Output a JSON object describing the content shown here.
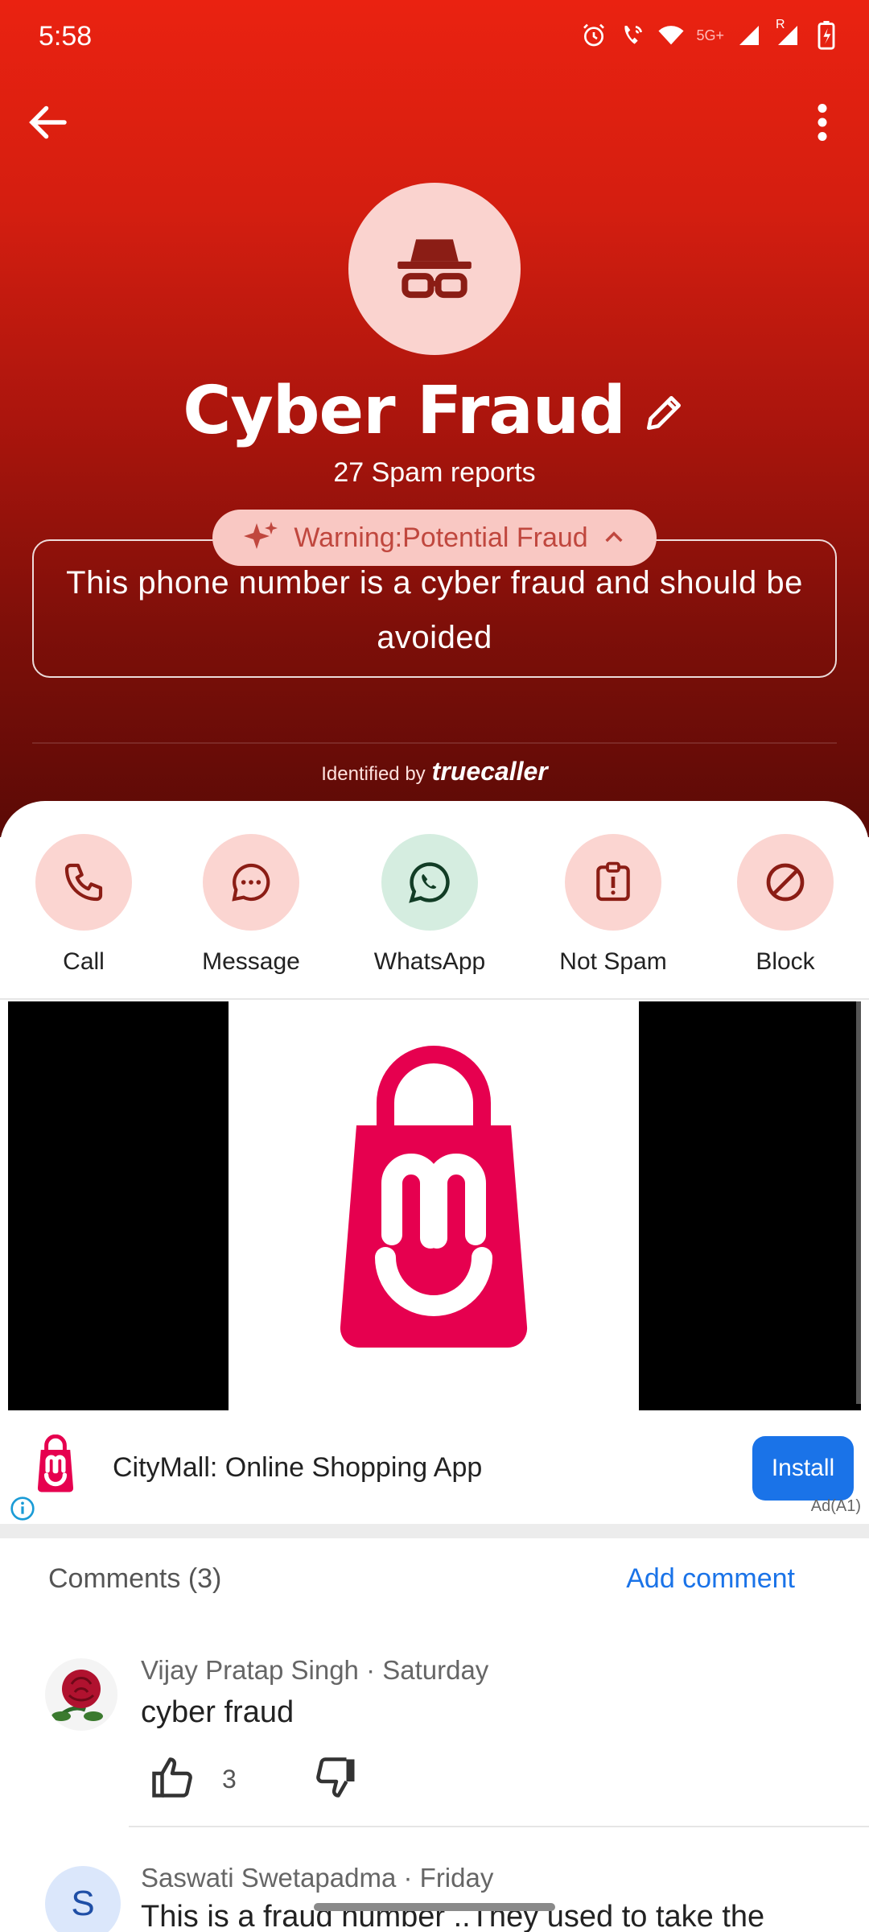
{
  "status_bar": {
    "time": "5:58",
    "network_label": "5G+",
    "roaming_label": "R"
  },
  "profile": {
    "title": "Cyber Fraud",
    "spam_reports": "27 Spam reports",
    "warning_label": "Warning:Potential Fraud",
    "warning_text": "This phone number is a cyber fraud and should be avoided",
    "identified_prefix": "Identified by",
    "identified_brand": "truecaller"
  },
  "actions": [
    {
      "label": "Call",
      "icon": "phone-icon"
    },
    {
      "label": "Message",
      "icon": "message-icon"
    },
    {
      "label": "WhatsApp",
      "icon": "whatsapp-icon"
    },
    {
      "label": "Not Spam",
      "icon": "not-spam-icon"
    },
    {
      "label": "Block",
      "icon": "block-icon"
    }
  ],
  "ad": {
    "app_name": "CityMall: Online Shopping App",
    "install_label": "Install",
    "tag": "Ad(A1)"
  },
  "comments": {
    "header": "Comments (3)",
    "add_label": "Add comment",
    "items": [
      {
        "author": "Vijay Pratap Singh · Saturday",
        "text": "cyber fraud",
        "likes": "3"
      },
      {
        "author": "Saswati Swetapadma · Friday",
        "initial": "S",
        "text": "This is a fraud number ..They used to take the"
      }
    ]
  },
  "colors": {
    "hero_top": "#ea2211",
    "hero_bottom": "#5b0a06",
    "action_bg": "#fbd5d1",
    "whatsapp_bg": "#d5ede0",
    "icon_dark_red": "#8b1d15",
    "link_blue": "#1a73e8",
    "brand_pink": "#e6004f"
  }
}
